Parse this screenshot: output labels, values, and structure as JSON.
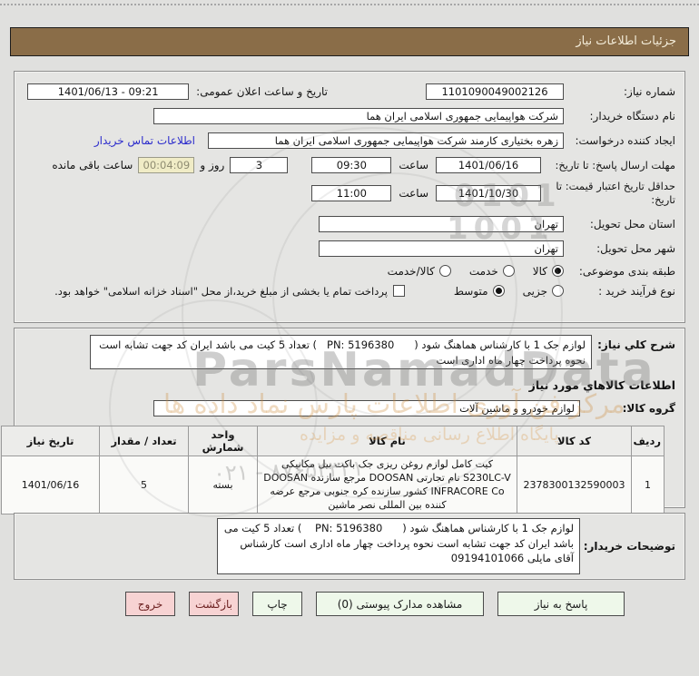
{
  "title_bar": {
    "title": "جزئیات اطلاعات نیاز"
  },
  "info": {
    "need_number_label": "شماره نیاز:",
    "need_number": "1101090049002126",
    "announce_label": "تاریخ و ساعت اعلان عمومی:",
    "announce_value": "09:21 - 1401/06/13",
    "buyer_org_label": "نام دستگاه خریدار:",
    "buyer_org": "شرکت هواپیمایی جمهوری اسلامی ایران هما",
    "creator_label": "ایجاد کننده درخواست:",
    "creator": "زهره بختیاری کارمند شرکت هواپیمایی جمهوری اسلامی ایران هما",
    "contact_link": "اطلاعات تماس خریدار",
    "deadline_label": "مهلت ارسال پاسخ: تا تاریخ:",
    "deadline_date": "1401/06/16",
    "hour_label": "ساعت",
    "deadline_time": "09:30",
    "days_value": "3",
    "days_suffix": "روز و",
    "countdown": "00:04:09",
    "remaining_label": "ساعت باقی مانده",
    "validity_label": "حداقل تاریخ اعتبار قیمت: تا تاریخ:",
    "validity_date": "1401/10/30",
    "validity_time": "11:00",
    "province_label": "استان محل تحویل:",
    "province": "تهران",
    "city_label": "شهر محل تحویل:",
    "city": "تهران",
    "classification_label": "طبقه بندی موضوعی:",
    "class_options": [
      {
        "label": "کالا",
        "selected": true
      },
      {
        "label": "خدمت",
        "selected": false
      },
      {
        "label": "کالا/خدمت",
        "selected": false
      }
    ],
    "process_label": "نوع فرآیند خرید :",
    "process_options": [
      {
        "label": "جزیی",
        "selected": false
      },
      {
        "label": "متوسط",
        "selected": true
      }
    ],
    "treasury_checkbox_label": "پرداخت تمام یا بخشی از مبلغ خرید،از محل \"اسناد خزانه اسلامی\" خواهد بود."
  },
  "need_desc": {
    "label": "شرح کلي نیاز:",
    "text": "لوازم جک 1 با کارشناس هماهنگ شود (      PN: 5196380   )  تعداد 5 کیت می باشد  ایران کد جهت تشابه است نحوه پرداخت چهار  ماه اداری است"
  },
  "goods_section": {
    "header": "اطلاعات کالاهاي مورد نیاز",
    "group_label": "گروه کالا:",
    "group_value": "لوازم خودرو و ماشین آلات",
    "table": {
      "headers": [
        "ردیف",
        "کد کالا",
        "نام کالا",
        "واحد شمارش",
        "تعداد / مقدار",
        "تاریخ نیاز"
      ],
      "rows": [
        {
          "row_no": "1",
          "code": "2378300132590003",
          "name": "کیت کامل لوازم روغن ریزی جک باکت بیل مکانیکی S230LC-V نام تجارتی DOOSAN مرجع سازنده DOOSAN INFRACORE Co کشور سازنده کره جنوبی مرجع عرضه کننده بین المللی نصر ماشین",
          "unit": "بسته",
          "qty": "5",
          "need_date": "1401/06/16"
        }
      ]
    }
  },
  "buyer_notes": {
    "label": "توضیحات خریدار:",
    "text": "لوازم جک 1 با کارشناس هماهنگ شود (      PN: 5196380    ) تعداد 5 کیت می باشد ایران کد جهت تشابه است نحوه پرداخت چهار  ماه اداری است کارشناس آقای مایلی 09194101066"
  },
  "buttons": [
    {
      "label": "پاسخ به نیاز"
    },
    {
      "label": "مشاهده مدارک پیوستی (0)"
    },
    {
      "label": "چاپ"
    },
    {
      "label": "بازگشت"
    },
    {
      "label": "خروج"
    }
  ],
  "watermarks": {
    "brand": "ParsNamadData",
    "fa_line1": "مرکز فن آوری اطلاعات پارس نماد داده ها",
    "fa_line2": "پایگاه اطلاع رسانی مناقصه و مزایده",
    "phone": "۰۲۱ - ۸۷۶۵۴۳۲۱",
    "num1": "0101",
    "num2": "1001"
  },
  "colors": {
    "title_bar_bg": "#8a6d48",
    "countdown_bg": "#f0ecc6",
    "button_green": "#eef8ea",
    "button_pink": "#f7d3d3",
    "link_blue": "#2b2bcc"
  }
}
